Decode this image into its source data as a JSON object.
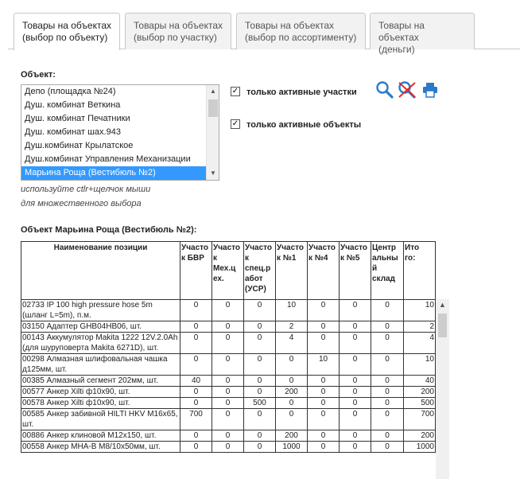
{
  "tabs": [
    {
      "line1": "Товары на объектах",
      "line2": "(выбор по объекту)"
    },
    {
      "line1": "Товары на объектах",
      "line2": "(выбор по участку)"
    },
    {
      "line1": "Товары на объектах",
      "line2": "(выбор по ассортименту)"
    },
    {
      "line1": "Товары на объектах",
      "line2": "(деньги)"
    }
  ],
  "object_label": "Объект:",
  "object_list": {
    "items": [
      "Депо (площадка №24)",
      "Душ. комбинат Веткина",
      "Душ. комбинат Печатники",
      "Душ. комбинат шах.943",
      "Душ.комбинат Крылатское",
      "Душ.комбинат Управления Механизации",
      "Марьина Роща (Вестибюль №2)"
    ],
    "selected": "Марьина Роща (Вестибюль №2)"
  },
  "hint": {
    "line1": "используйте ctlr+щелчок мыши",
    "line2": "для множественного выбора"
  },
  "filters": {
    "active_sections": {
      "label": "только активные участки",
      "checked": true
    },
    "active_objects": {
      "label": "только активные объекты",
      "checked": true
    }
  },
  "icons": {
    "search": "search-icon",
    "clear": "clear-search-icon",
    "print": "print-icon"
  },
  "colors": {
    "accent": "#3399ff",
    "icon_blue": "#2b7ac8",
    "icon_red": "#d9302c"
  },
  "object_title": "Объект Марьина Роща (Вестибюль №2):",
  "table": {
    "headers": [
      "Наименование позиции",
      "Участок БВР",
      "Участок Мех.цех.",
      "Участок спец.работ (УСР)",
      "Участок №1",
      "Участок №4",
      "Участок №5",
      "Центральный склад",
      "Итого:"
    ],
    "header_lines": [
      [
        "Наименование позиции"
      ],
      [
        "Участо",
        "к БВР"
      ],
      [
        "Участо",
        "к",
        "Мех.ц",
        "ех."
      ],
      [
        "Участо",
        "к",
        "спец.р",
        "абот",
        "(УСР)"
      ],
      [
        "Участо",
        "к №1"
      ],
      [
        "Участо",
        "к №4"
      ],
      [
        "Участо",
        "к №5"
      ],
      [
        "Центр",
        "альны",
        "й",
        "склад"
      ],
      [
        "Ито",
        "го:"
      ]
    ],
    "rows": [
      {
        "name": "02733 IP 100 high pressure hose 5m (шланг L=5m), п.м.",
        "values": [
          "0",
          "0",
          "0",
          "10",
          "0",
          "0",
          "0"
        ],
        "total": "10"
      },
      {
        "name": "03150 Адаптер GHB04HB06, шт.",
        "values": [
          "0",
          "0",
          "0",
          "2",
          "0",
          "0",
          "0"
        ],
        "total": "2"
      },
      {
        "name": "00143 Аккумулятор Makita 1222 12V.2.0Ah (для шуруповерта Makita 6271D), шт.",
        "values": [
          "0",
          "0",
          "0",
          "4",
          "0",
          "0",
          "0"
        ],
        "total": "4"
      },
      {
        "name": "00298 Алмазная шлифовальная чашка д125мм, шт.",
        "values": [
          "0",
          "0",
          "0",
          "0",
          "10",
          "0",
          "0"
        ],
        "total": "10"
      },
      {
        "name": "00385 Алмазный сегмент 202мм, шт.",
        "values": [
          "40",
          "0",
          "0",
          "0",
          "0",
          "0",
          "0"
        ],
        "total": "40"
      },
      {
        "name": "00577 Анкер Xilti ф10х90, шт.",
        "values": [
          "0",
          "0",
          "0",
          "200",
          "0",
          "0",
          "0"
        ],
        "total": "200"
      },
      {
        "name": "00578 Анкер Xilti ф10х90, шт.",
        "values": [
          "0",
          "0",
          "500",
          "0",
          "0",
          "0",
          "0"
        ],
        "total": "500"
      },
      {
        "name": "00585 Анкер забивной HILTI HKV M16x65, шт.",
        "values": [
          "700",
          "0",
          "0",
          "0",
          "0",
          "0",
          "0"
        ],
        "total": "700"
      },
      {
        "name": "00886 Анкер клиновой М12х150, шт.",
        "values": [
          "0",
          "0",
          "0",
          "200",
          "0",
          "0",
          "0"
        ],
        "total": "200"
      },
      {
        "name": "00558 Анкер MHA-B M8/10x50мм, шт.",
        "values": [
          "0",
          "0",
          "0",
          "1000",
          "0",
          "0",
          "0"
        ],
        "total": "1000"
      }
    ]
  }
}
